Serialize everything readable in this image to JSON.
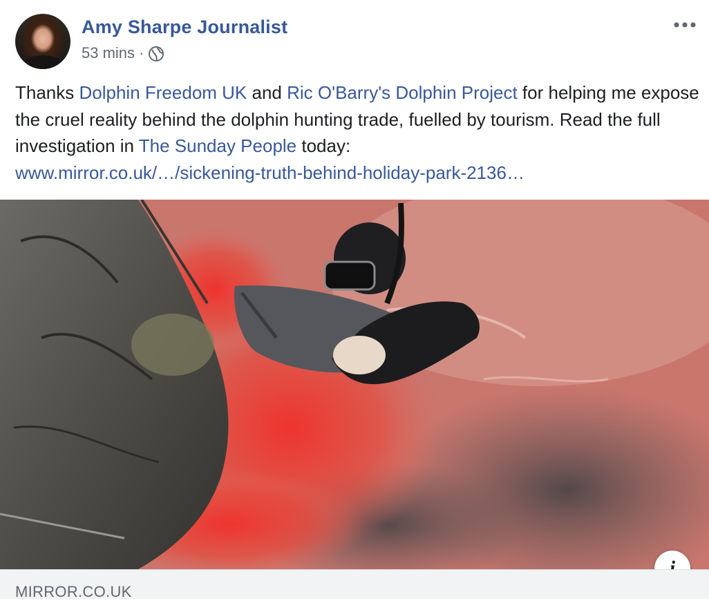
{
  "post": {
    "author": "Amy Sharpe Journalist",
    "time": "53 mins",
    "separator": "·",
    "privacy_icon": "globe-icon",
    "more_icon": "more-options-icon",
    "text": {
      "t1": "Thanks ",
      "link1": "Dolphin Freedom UK",
      "t2": " and ",
      "link2": "Ric O'Barry's Dolphin Project",
      "t3": " for helping me expose the cruel reality behind the dolphin hunting trade, fuelled by tourism. Read the full investigation in ",
      "link3": "The Sunday People",
      "t4": " today:",
      "url": "www.mirror.co.uk/…/sickening-truth-behind-holiday-park-2136…"
    }
  },
  "link_preview": {
    "info_label": "i",
    "domain": "MIRROR.CO.UK"
  },
  "colors": {
    "link": "#385898",
    "meta": "#606770",
    "text": "#1c1e21",
    "preview_bar": "#f2f3f5"
  }
}
